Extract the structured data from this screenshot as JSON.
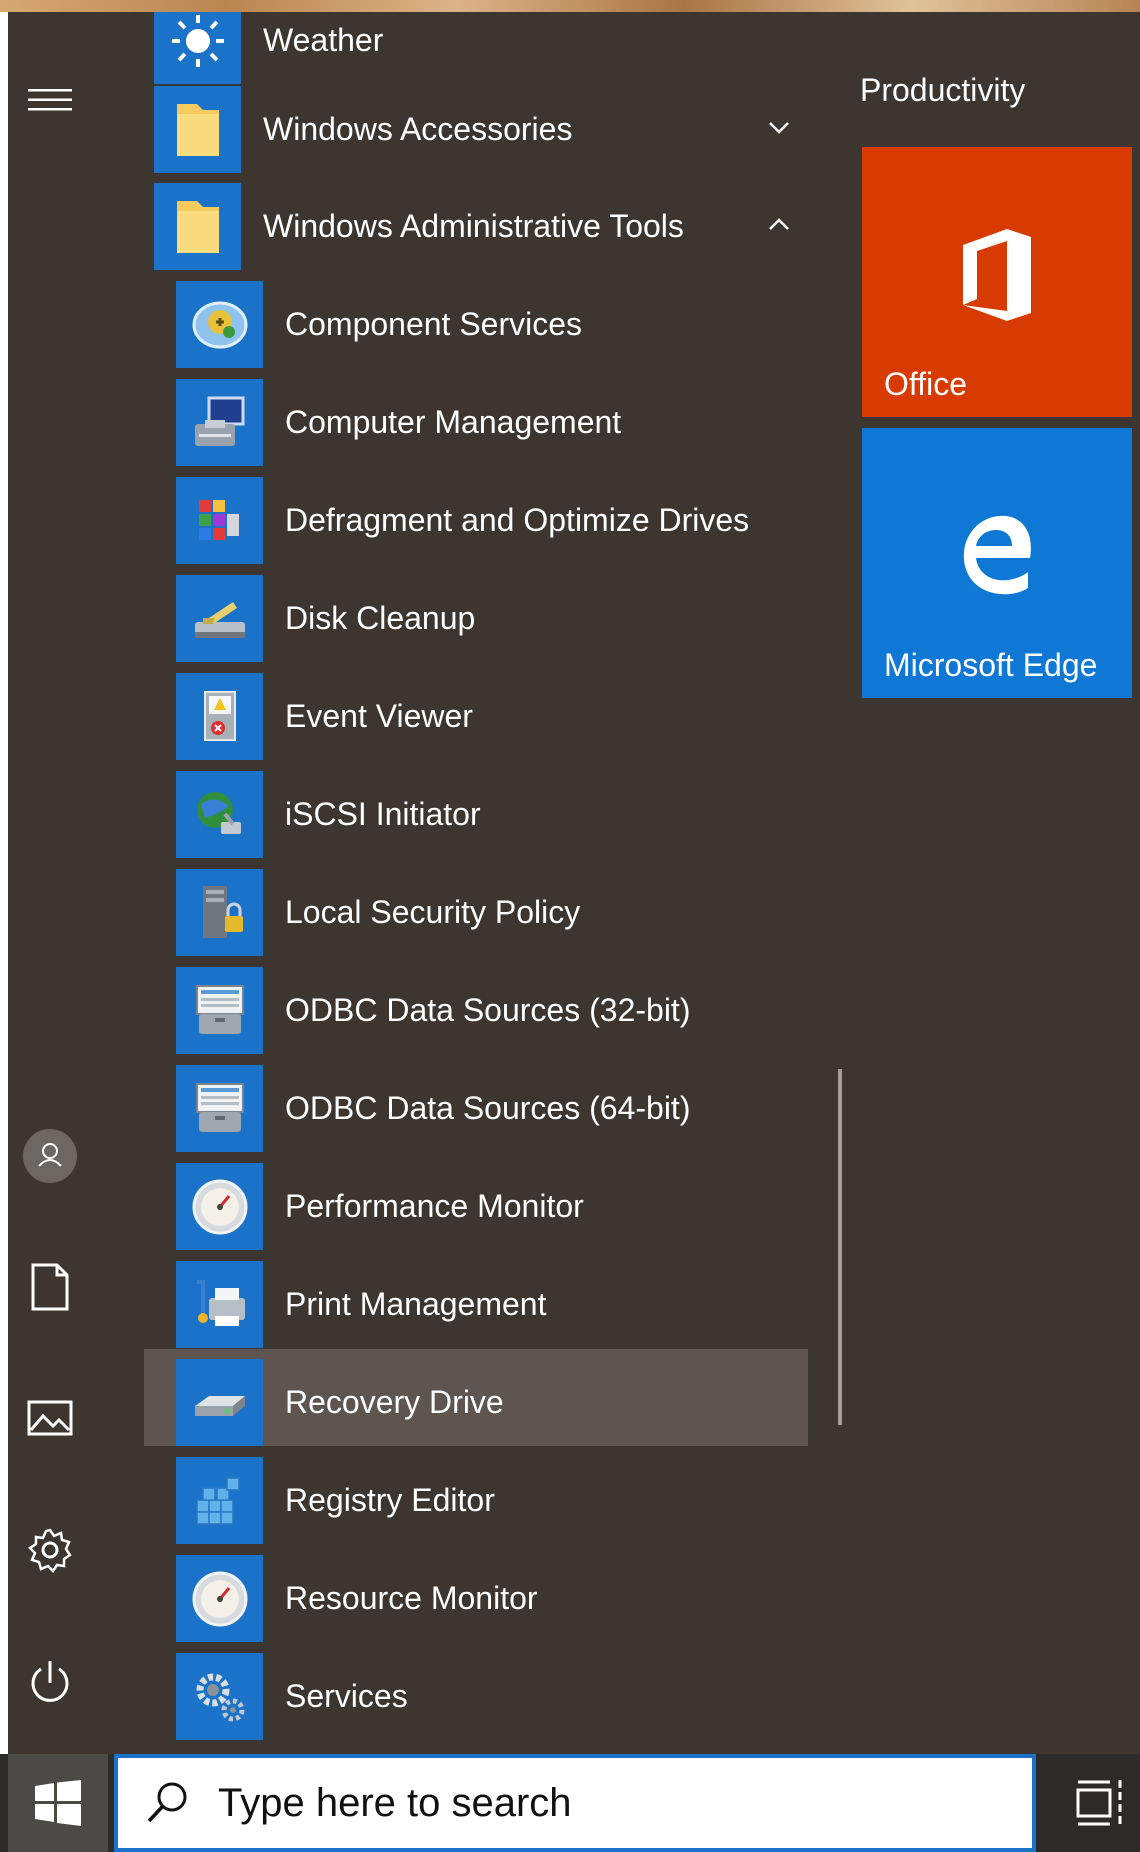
{
  "search": {
    "placeholder": "Type here to search"
  },
  "tiles_group": {
    "title": "Productivity"
  },
  "tiles": [
    {
      "name": "Office",
      "color": "#d83b01",
      "icon": "office-logo"
    },
    {
      "name": "Microsoft Edge",
      "color": "#0f78d4",
      "icon": "edge-logo"
    }
  ],
  "apps": [
    {
      "label": "Weather",
      "icon": "weather-icon"
    },
    {
      "label": "Windows Accessories",
      "icon": "folder-icon",
      "expanded": false
    },
    {
      "label": "Windows Administrative Tools",
      "icon": "folder-icon",
      "expanded": true
    },
    {
      "label": "Component Services",
      "icon": "component-services-icon"
    },
    {
      "label": "Computer Management",
      "icon": "computer-management-icon"
    },
    {
      "label": "Defragment and Optimize Drives",
      "icon": "defrag-icon"
    },
    {
      "label": "Disk Cleanup",
      "icon": "disk-cleanup-icon"
    },
    {
      "label": "Event Viewer",
      "icon": "event-viewer-icon"
    },
    {
      "label": "iSCSI Initiator",
      "icon": "iscsi-icon"
    },
    {
      "label": "Local Security Policy",
      "icon": "security-policy-icon"
    },
    {
      "label": "ODBC Data Sources (32-bit)",
      "icon": "odbc-icon"
    },
    {
      "label": "ODBC Data Sources (64-bit)",
      "icon": "odbc-icon"
    },
    {
      "label": "Performance Monitor",
      "icon": "gauge-icon"
    },
    {
      "label": "Print Management",
      "icon": "print-management-icon"
    },
    {
      "label": "Recovery Drive",
      "icon": "recovery-drive-icon",
      "hovered": true
    },
    {
      "label": "Registry Editor",
      "icon": "registry-editor-icon"
    },
    {
      "label": "Resource Monitor",
      "icon": "gauge-icon"
    },
    {
      "label": "Services",
      "icon": "gears-icon"
    }
  ],
  "rail": [
    "hamburger-menu-icon",
    "user-icon",
    "documents-icon",
    "pictures-icon",
    "settings-icon",
    "power-icon"
  ],
  "colors": {
    "background": "#3d3630",
    "accent": "#1a73c9",
    "highlight": "#5e5550"
  }
}
